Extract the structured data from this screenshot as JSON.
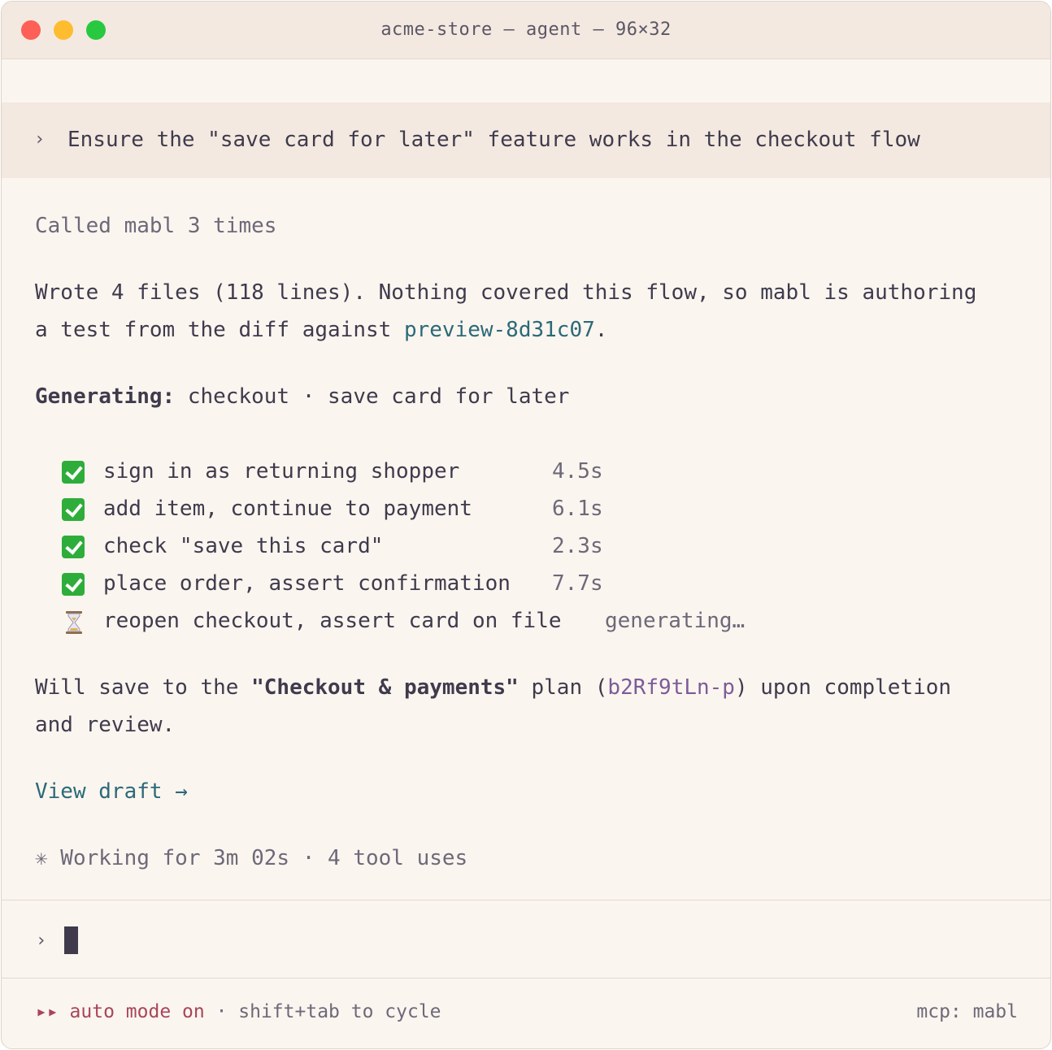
{
  "window": {
    "title": "acme-store — agent — 96×32"
  },
  "prompt": {
    "caret": "›",
    "text": "Ensure the \"save card for later\" feature works in the checkout flow"
  },
  "transcript": {
    "called": "Called mabl 3 times",
    "wrote_line1": "Wrote 4 files (118 lines). Nothing covered this flow, so mabl is authoring",
    "wrote_line2_prefix": "a test from the diff against ",
    "wrote_line2_link": "preview-8d31c07",
    "wrote_line2_suffix": ".",
    "generating_label": "Generating:",
    "generating_value": " checkout · save card for later",
    "steps": [
      {
        "status": "done",
        "label": "sign in as returning shopper",
        "time": "4.5s"
      },
      {
        "status": "done",
        "label": "add item, continue to payment",
        "time": "6.1s"
      },
      {
        "status": "done",
        "label": "check \"save this card\"",
        "time": "2.3s"
      },
      {
        "status": "done",
        "label": "place order, assert confirmation",
        "time": "7.7s"
      },
      {
        "status": "pending",
        "label": "reopen checkout, assert card on file",
        "time": "generating…"
      }
    ],
    "save_prefix": "Will save to the ",
    "save_plan": "\"Checkout & payments\"",
    "save_middle": " plan (",
    "save_plan_id": "b2Rf9tLn-p",
    "save_suffix": ") upon completion",
    "save_line2": "and review.",
    "view_draft": "View draft →",
    "working": "✳ Working for 3m 02s · 4 tool uses"
  },
  "input": {
    "caret": "›"
  },
  "footer": {
    "auto_mode": "▸▸ auto mode on",
    "hint": " · shift+tab to cycle",
    "mcp": "mcp: mabl"
  },
  "colors": {
    "background": "#fbf5ef",
    "titlebar": "#f3e9e0",
    "link": "#2b6a78",
    "plan_id": "#7c5c98",
    "auto_mode": "#a8455a",
    "success": "#2fad3a"
  },
  "icons": {
    "done": "check-mark-icon",
    "pending": "hourglass-icon"
  }
}
